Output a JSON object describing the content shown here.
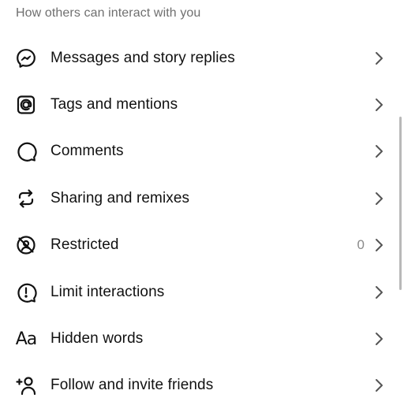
{
  "section": {
    "title": "How others can interact with you"
  },
  "items": [
    {
      "label": "Messages and story replies",
      "icon": "messenger-icon",
      "count": ""
    },
    {
      "label": "Tags and mentions",
      "icon": "at-sign-icon",
      "count": ""
    },
    {
      "label": "Comments",
      "icon": "comment-bubble-icon",
      "count": ""
    },
    {
      "label": "Sharing and remixes",
      "icon": "share-remix-icon",
      "count": ""
    },
    {
      "label": "Restricted",
      "icon": "restricted-icon",
      "count": "0"
    },
    {
      "label": "Limit interactions",
      "icon": "limit-alert-icon",
      "count": ""
    },
    {
      "label": "Hidden words",
      "icon": "text-aa-icon",
      "icon_text": "Aa",
      "count": ""
    },
    {
      "label": "Follow and invite friends",
      "icon": "add-person-icon",
      "count": ""
    }
  ]
}
